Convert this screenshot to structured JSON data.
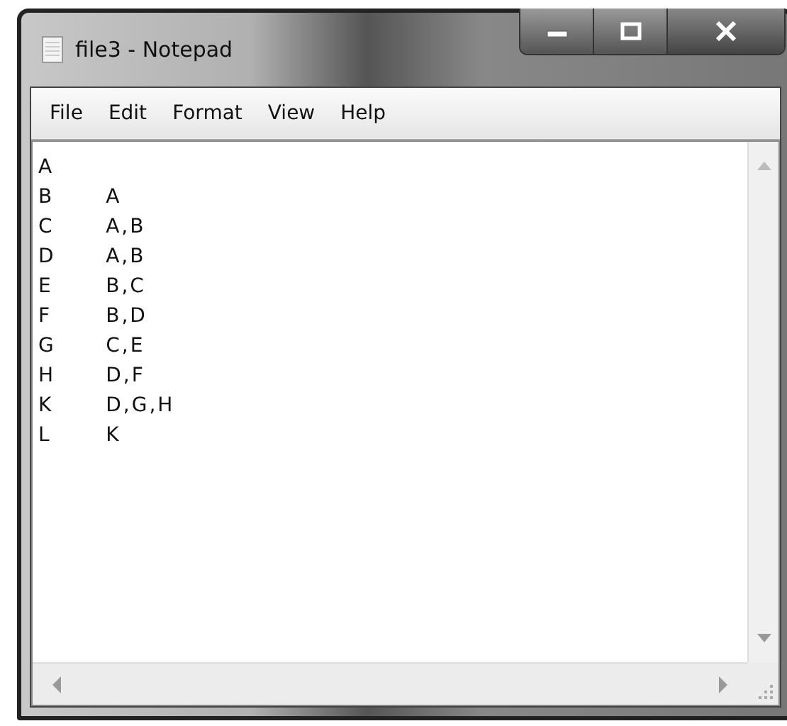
{
  "window": {
    "title": "file3 - Notepad"
  },
  "menu": [
    "File",
    "Edit",
    "Format",
    "View",
    "Help"
  ],
  "document": {
    "lines": [
      "A",
      "B\tA",
      "C\tA,B",
      "D\tA,B",
      "E\tB,C",
      "F\tB,D",
      "G\tC,E",
      "H\tD,F",
      "K\tD,G,H",
      "L\tK"
    ]
  }
}
